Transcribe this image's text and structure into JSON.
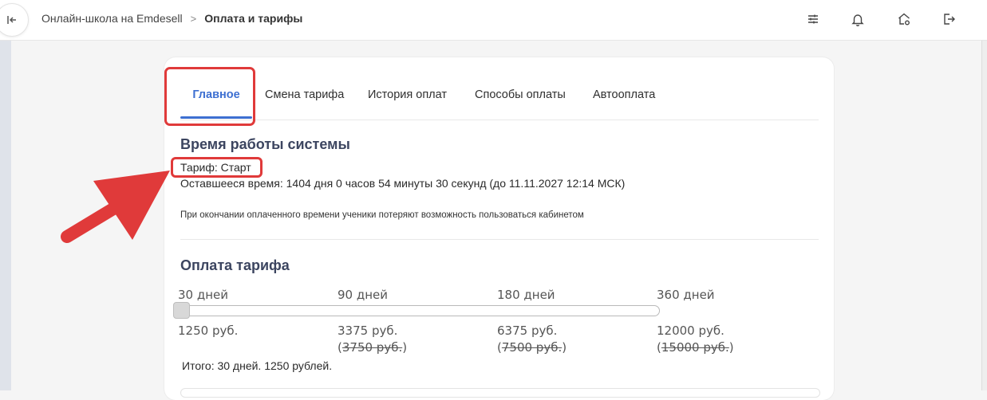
{
  "header": {
    "collapse_icon": "collapse-left-icon",
    "breadcrumb": [
      "Онлайн-школа на Emdesell",
      "Оплата и тарифы"
    ],
    "breadcrumb_separator": ">",
    "icons": [
      "sliders-icon",
      "bell-icon",
      "home-settings-icon",
      "logout-icon"
    ]
  },
  "tabs": [
    {
      "label": "Главное",
      "active": true
    },
    {
      "label": "Смена тарифа",
      "active": false
    },
    {
      "label": "История оплат",
      "active": false
    },
    {
      "label": "Способы оплаты",
      "active": false
    },
    {
      "label": "Автооплата",
      "active": false
    }
  ],
  "system": {
    "title": "Время работы системы",
    "tariff": "Тариф: Старт",
    "remaining": "Оставшееся время: 1404 дня 0 часов 54 минуты 30 секунд (до 11.11.2027 12:14 МСК)",
    "note": "При окончании оплаченного времени ученики потеряют возможность пользоваться кабинетом"
  },
  "payment": {
    "title": "Оплата тарифа",
    "options": [
      {
        "period": "30 дней",
        "price": "1250 руб.",
        "old_open": "",
        "old_price": "",
        "old_close": ""
      },
      {
        "period": "90 дней",
        "price": "3375 руб.",
        "old_open": "(",
        "old_price": "3750 руб.",
        "old_close": ")"
      },
      {
        "period": "180 дней",
        "price": "6375 руб.",
        "old_open": "(",
        "old_price": "7500 руб.",
        "old_close": ")"
      },
      {
        "period": "360 дней",
        "price": "12000 руб.",
        "old_open": "(",
        "old_price": "15000 руб.",
        "old_close": ")"
      }
    ],
    "slider_position": 0,
    "total": "Итого: 30 дней. 1250 рублей."
  },
  "colors": {
    "accent": "#3d6fd1",
    "highlight": "#e03a3a"
  }
}
